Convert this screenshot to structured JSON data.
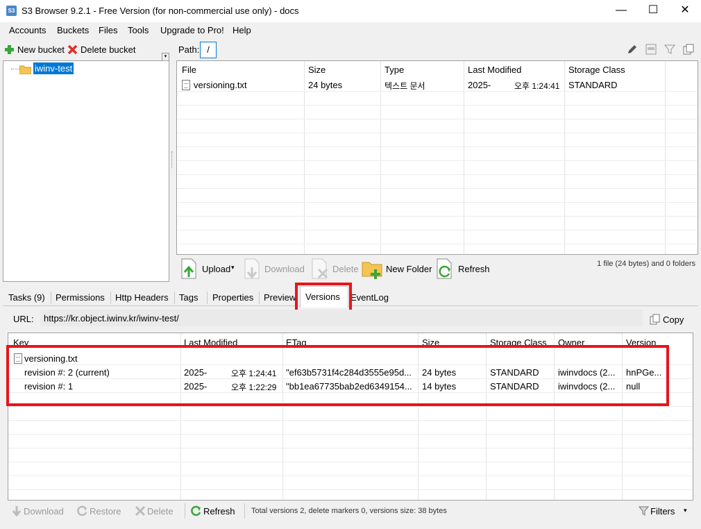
{
  "window": {
    "title": "S3 Browser 9.2.1 - Free Version (for non-commercial use only) - docs",
    "app_icon": "S3",
    "minimize": "—",
    "maximize": "☐",
    "close": "✕"
  },
  "menu": [
    "Accounts",
    "Buckets",
    "Files",
    "Tools",
    "Upgrade to Pro!",
    "Help"
  ],
  "bucket_toolbar": {
    "new_bucket": "New bucket",
    "delete_bucket": "Delete bucket"
  },
  "buckets": [
    "iwinv-test"
  ],
  "path": {
    "label": "Path:",
    "value": "/"
  },
  "files": {
    "columns": [
      "File",
      "Size",
      "Type",
      "Last Modified",
      "Storage Class"
    ],
    "rows": [
      {
        "name": "versioning.txt",
        "size": "24 bytes",
        "type": "텍스트 문서",
        "date": "2025-",
        "time": "오후 1:24:41",
        "storage": "STANDARD"
      }
    ]
  },
  "file_toolbar": {
    "upload": "Upload",
    "download": "Download",
    "delete": "Delete",
    "new_folder": "New Folder",
    "refresh": "Refresh",
    "summary": "1 file (24 bytes) and 0 folders"
  },
  "tabs": [
    "Tasks (9)",
    "Permissions",
    "Http Headers",
    "Tags",
    "Properties",
    "Preview",
    "Versions",
    "EventLog"
  ],
  "active_tab": "Versions",
  "url_bar": {
    "label": "URL:",
    "value": "https://kr.object.iwinv.kr/iwinv-test/",
    "copy": "Copy"
  },
  "versions": {
    "columns": [
      "Key",
      "Last Modified",
      "ETag",
      "Size",
      "Storage Class",
      "Owner",
      "Version"
    ],
    "parent": "versioning.txt",
    "rows": [
      {
        "key": "revision #: 2 (current)",
        "date": "2025-",
        "time": "오후 1:24:41",
        "etag": "\"ef63b5731f4c284d3555e95d...",
        "size": "24 bytes",
        "storage": "STANDARD",
        "owner": "iwinvdocs (2...",
        "version": "hnPGe..."
      },
      {
        "key": "revision #: 1",
        "date": "2025-",
        "time": "오후 1:22:29",
        "etag": "\"bb1ea67735bab2ed6349154...",
        "size": "14 bytes",
        "storage": "STANDARD",
        "owner": "iwinvdocs (2...",
        "version": "null"
      }
    ]
  },
  "versions_toolbar": {
    "download": "Download",
    "restore": "Restore",
    "delete": "Delete",
    "refresh": "Refresh",
    "summary": "Total versions 2, delete markers 0, versions size: 38 bytes",
    "filters": "Filters"
  },
  "colors": {
    "highlight": "#e8141b",
    "selection": "#0078d7",
    "folder": "#f5c451"
  }
}
